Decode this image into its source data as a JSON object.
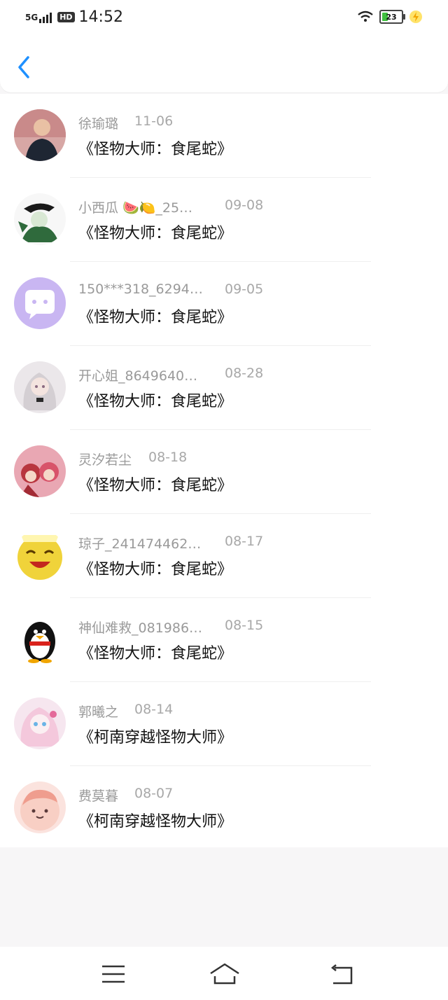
{
  "status_bar": {
    "network": "5G",
    "hd": "HD",
    "time": "14:52",
    "battery": "23"
  },
  "header": {
    "back_icon": "chevron-left-icon"
  },
  "rows": [
    {
      "name": "徐瑜璐",
      "date": "11-06",
      "title": "《怪物大师：食尾蛇》",
      "avatar_color": "#c98a8a"
    },
    {
      "name": "小西瓜 🍉🍋_25…",
      "date": "09-08",
      "title": "《怪物大师：食尾蛇》",
      "avatar_color": "#2f5a3a"
    },
    {
      "name": "150***318_6294…",
      "date": "09-05",
      "title": "《怪物大师：食尾蛇》",
      "avatar_color": "#c9b6f2"
    },
    {
      "name": "开心姐_8649640…",
      "date": "08-28",
      "title": "《怪物大师：食尾蛇》",
      "avatar_color": "#d9d3d8"
    },
    {
      "name": "灵汐若尘",
      "date": "08-18",
      "title": "《怪物大师：食尾蛇》",
      "avatar_color": "#c94a5a"
    },
    {
      "name": "琼子_241474462…",
      "date": "08-17",
      "title": "《怪物大师：食尾蛇》",
      "avatar_color": "#f0d33a"
    },
    {
      "name": "神仙难救_081986…",
      "date": "08-15",
      "title": "《怪物大师：食尾蛇》",
      "avatar_color": "#111111"
    },
    {
      "name": "郭曦之",
      "date": "08-14",
      "title": "《柯南穿越怪物大师》",
      "avatar_color": "#f3d6e6"
    },
    {
      "name": "费莫暮",
      "date": "08-07",
      "title": "《柯南穿越怪物大师》",
      "avatar_color": "#f2b7a8"
    }
  ],
  "bottom_nav": {
    "menu_icon": "menu-icon",
    "home_icon": "home-icon",
    "back_icon": "return-icon"
  }
}
